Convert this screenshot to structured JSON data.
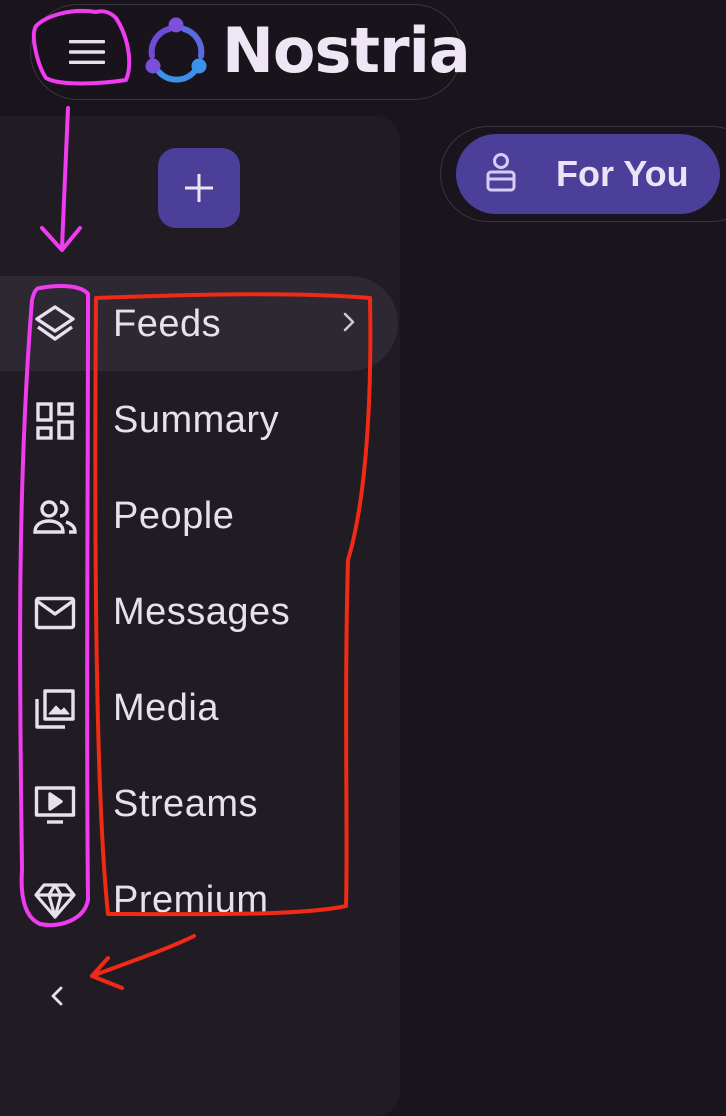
{
  "app": {
    "brand": "Nostria",
    "colors": {
      "background": "#1a141d",
      "sidebar": "#211b24",
      "accent": "#4b3f9a",
      "active_item": "#2e2832",
      "annotation_magenta": "#f03cf0",
      "annotation_red": "#f02a14"
    }
  },
  "header": {
    "menu_icon": "hamburger-menu-icon",
    "logo_icon": "nostria-logo-icon"
  },
  "sidebar": {
    "create_icon": "plus-icon",
    "items": [
      {
        "label": "Feeds",
        "icon": "layers-icon",
        "active": true,
        "has_submenu": true
      },
      {
        "label": "Summary",
        "icon": "dashboard-icon"
      },
      {
        "label": "People",
        "icon": "people-icon"
      },
      {
        "label": "Messages",
        "icon": "mail-icon"
      },
      {
        "label": "Media",
        "icon": "photo-library-icon"
      },
      {
        "label": "Streams",
        "icon": "live-tv-icon"
      },
      {
        "label": "Premium",
        "icon": "diamond-icon"
      }
    ],
    "collapse_icon": "chevron-left-icon"
  },
  "feed_tabs": [
    {
      "label": "For You",
      "icon": "person-feed-icon",
      "selected": true
    }
  ]
}
